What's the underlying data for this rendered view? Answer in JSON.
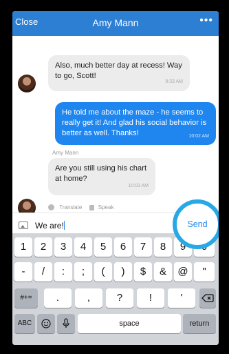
{
  "header": {
    "close_label": "Close",
    "title": "Amy Mann",
    "more_label": "•••"
  },
  "messages": [
    {
      "direction": "incoming",
      "text": "Also, much better day at recess! Way to go, Scott!",
      "time": "9:33 AM"
    },
    {
      "direction": "outgoing",
      "text": "He told me about the maze - he seems to really get it! And glad his social behavior is better as well. Thanks!",
      "time": "10:02 AM"
    },
    {
      "direction": "incoming",
      "sender": "Amy Mann",
      "text": "Are you still using his chart at home?",
      "time": "10:03 AM"
    }
  ],
  "actions": {
    "translate_label": "Translate",
    "speak_label": "Speak"
  },
  "composer": {
    "text": "We are!",
    "send_label": "Send"
  },
  "keyboard": {
    "row1": [
      "1",
      "2",
      "3",
      "4",
      "5",
      "6",
      "7",
      "8",
      "9",
      "0"
    ],
    "row2": [
      "-",
      "/",
      ":",
      ";",
      "(",
      ")",
      "$",
      "&",
      "@",
      "\""
    ],
    "row3": [
      ".",
      ",",
      "?",
      "!",
      "'"
    ],
    "symbols_label": "#+=",
    "abc_label": "ABC",
    "space_label": "space",
    "return_label": "return"
  },
  "colors": {
    "header": "#2d7fd3",
    "outgoing_bubble": "#1f86f0",
    "highlight_ring": "#29a8e6"
  }
}
